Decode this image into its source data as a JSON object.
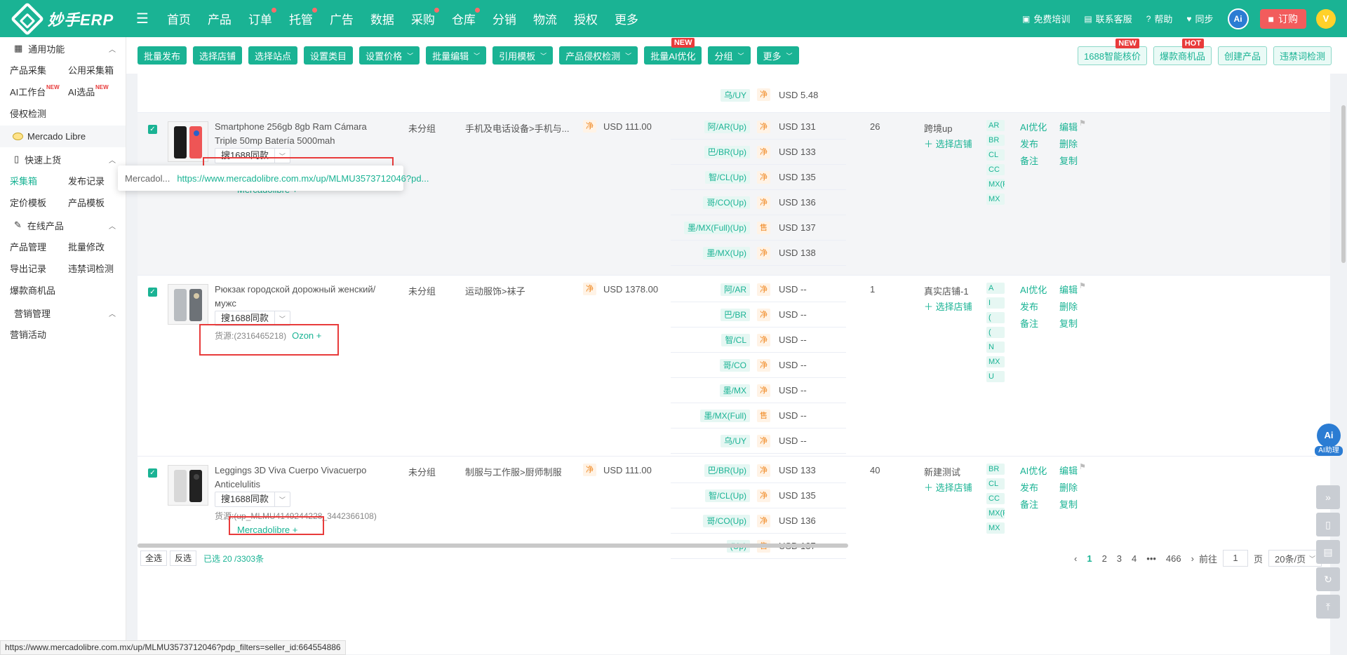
{
  "header": {
    "logo_text": "妙手ERP",
    "nav": [
      {
        "label": "首页",
        "dot": false
      },
      {
        "label": "产品",
        "dot": false
      },
      {
        "label": "订单",
        "dot": true
      },
      {
        "label": "托管",
        "dot": true
      },
      {
        "label": "广告",
        "dot": false
      },
      {
        "label": "数据",
        "dot": false
      },
      {
        "label": "采购",
        "dot": true
      },
      {
        "label": "仓库",
        "dot": true
      },
      {
        "label": "分销",
        "dot": false
      },
      {
        "label": "物流",
        "dot": false
      },
      {
        "label": "授权",
        "dot": false
      },
      {
        "label": "更多",
        "dot": false
      }
    ],
    "right": {
      "training": "免费培训",
      "support": "联系客服",
      "help": "帮助",
      "sync": "同步",
      "ai": "Ai",
      "order": "订购",
      "avatar": "V"
    }
  },
  "sidebar": {
    "common": {
      "title": "通用功能",
      "items": [
        {
          "label": "产品采集",
          "badge": ""
        },
        {
          "label": "公用采集箱",
          "badge": ""
        },
        {
          "label": "AI工作台",
          "badge": "NEW"
        },
        {
          "label": "AI选品",
          "badge": "NEW"
        }
      ],
      "single": "侵权检测"
    },
    "platform": "Mercado Libre",
    "quick": {
      "title": "快速上货",
      "items": [
        "采集箱",
        "发布记录",
        "定价模板",
        "产品模板"
      ]
    },
    "online": {
      "title": "在线产品",
      "items": [
        "产品管理",
        "批量修改",
        "导出记录",
        "违禁词检测"
      ],
      "single": "爆款商机品"
    },
    "marketing": {
      "title": "营销管理",
      "single": "营销活动"
    }
  },
  "toolbar": {
    "buttons": [
      {
        "label": "批量发布",
        "dropdown": false,
        "badge": ""
      },
      {
        "label": "选择店铺",
        "dropdown": false,
        "badge": ""
      },
      {
        "label": "选择站点",
        "dropdown": false,
        "badge": ""
      },
      {
        "label": "设置类目",
        "dropdown": false,
        "badge": ""
      },
      {
        "label": "设置价格",
        "dropdown": true,
        "badge": ""
      },
      {
        "label": "批量编辑",
        "dropdown": true,
        "badge": ""
      },
      {
        "label": "引用模板",
        "dropdown": true,
        "badge": ""
      },
      {
        "label": "产品侵权检测",
        "dropdown": true,
        "badge": ""
      },
      {
        "label": "批量AI优化",
        "dropdown": false,
        "badge": "NEW"
      },
      {
        "label": "分组",
        "dropdown": true,
        "badge": ""
      },
      {
        "label": "更多",
        "dropdown": true,
        "badge": ""
      }
    ],
    "right_buttons": [
      {
        "label": "1688智能核价",
        "badge": "NEW"
      },
      {
        "label": "爆款商机品",
        "badge": "HOT"
      },
      {
        "label": "创建产品",
        "badge": ""
      },
      {
        "label": "违禁词检测",
        "badge": ""
      }
    ]
  },
  "top_partial": {
    "site": "乌/UY",
    "tag": "净",
    "price": "USD 5.48"
  },
  "products": [
    {
      "title": "Smartphone 256gb 8gb Ram Cámara Triple 50mp Batería 5000mah",
      "search_label": "搜1688同款",
      "source_prefix": "货源:",
      "source_id": "(up_MLMU3573712046_664554886)",
      "source_link": "Mercadolibre",
      "group": "未分组",
      "category": "手机及电话设备>手机与...",
      "price_tag": "净",
      "price": "USD 111.00",
      "sites": [
        {
          "code": "阿/AR(Up)",
          "tag": "净",
          "price": "USD 131"
        },
        {
          "code": "巴/BR(Up)",
          "tag": "净",
          "price": "USD 133"
        },
        {
          "code": "智/CL(Up)",
          "tag": "净",
          "price": "USD 135"
        },
        {
          "code": "哥/CO(Up)",
          "tag": "净",
          "price": "USD 136"
        },
        {
          "code": "墨/MX(Full)(Up)",
          "tag": "售",
          "price": "USD 137"
        },
        {
          "code": "墨/MX(Up)",
          "tag": "净",
          "price": "USD 138"
        }
      ],
      "qty": "26",
      "store": "跨境up",
      "add_store": "选择店铺",
      "codes": [
        "AR",
        "BR",
        "CL",
        "CC",
        "MX(F",
        "MX"
      ],
      "ops": [
        "AI优化",
        "编辑",
        "发布",
        "删除",
        "备注",
        "复制"
      ]
    },
    {
      "title": "Рюкзак городской дорожный женский/мужс",
      "search_label": "搜1688同款",
      "source_prefix": "货源:",
      "source_id": "(2316465218)",
      "source_link": "Ozon",
      "group": "未分组",
      "category": "运动服饰>袜子",
      "price_tag": "净",
      "price": "USD 1378.00",
      "sites": [
        {
          "code": "阿/AR",
          "tag": "净",
          "price": "USD --"
        },
        {
          "code": "巴/BR",
          "tag": "净",
          "price": "USD --"
        },
        {
          "code": "智/CL",
          "tag": "净",
          "price": "USD --"
        },
        {
          "code": "哥/CO",
          "tag": "净",
          "price": "USD --"
        },
        {
          "code": "墨/MX",
          "tag": "净",
          "price": "USD --"
        },
        {
          "code": "墨/MX(Full)",
          "tag": "售",
          "price": "USD --"
        },
        {
          "code": "乌/UY",
          "tag": "净",
          "price": "USD --"
        }
      ],
      "qty": "1",
      "store": "真实店铺-1",
      "add_store": "选择店铺",
      "codes": [
        "A",
        "I",
        "(",
        "(",
        "N",
        "MX",
        "U"
      ],
      "ops": [
        "AI优化",
        "编辑",
        "发布",
        "删除",
        "备注",
        "复制"
      ]
    },
    {
      "title": "Leggings 3D Viva Cuerpo Vivacuerpo Anticelulitis",
      "search_label": "搜1688同款",
      "source_prefix": "货源:",
      "source_id": "(up_MLMU4149244228_3442366108)",
      "source_link": "Mercadolibre",
      "group": "未分组",
      "category": "制服与工作服>厨师制服",
      "price_tag": "净",
      "price": "USD 111.00",
      "sites": [
        {
          "code": "巴/BR(Up)",
          "tag": "净",
          "price": "USD 133"
        },
        {
          "code": "智/CL(Up)",
          "tag": "净",
          "price": "USD 135"
        },
        {
          "code": "哥/CO(Up)",
          "tag": "净",
          "price": "USD 136"
        },
        {
          "code": "(Up)",
          "tag": "售",
          "price": "USD 137"
        }
      ],
      "qty": "40",
      "store": "新建测试",
      "add_store": "选择店铺",
      "codes": [
        "BR",
        "CL",
        "CC",
        "MX(F",
        "MX"
      ],
      "ops": [
        "AI优化",
        "编辑",
        "发布",
        "删除",
        "备注",
        "复制"
      ]
    }
  ],
  "tooltip": {
    "key": "Mercadol...",
    "url": "https://www.mercadolibre.com.mx/up/MLMU3573712046?pd..."
  },
  "footer": {
    "select_all": "全选",
    "invert": "反选",
    "selected": "已选 20 /3303条",
    "pages": [
      "1",
      "2",
      "3",
      "4",
      "•••",
      "466"
    ],
    "goto_label": "前往",
    "goto_value": "1",
    "page_unit": "页",
    "page_size": "20条/页"
  },
  "float": {
    "ai_label": "AI助理",
    "ai": "Ai"
  },
  "statusbar": "https://www.mercadolibre.com.mx/up/MLMU3573712046?pdp_filters=seller_id:664554886"
}
